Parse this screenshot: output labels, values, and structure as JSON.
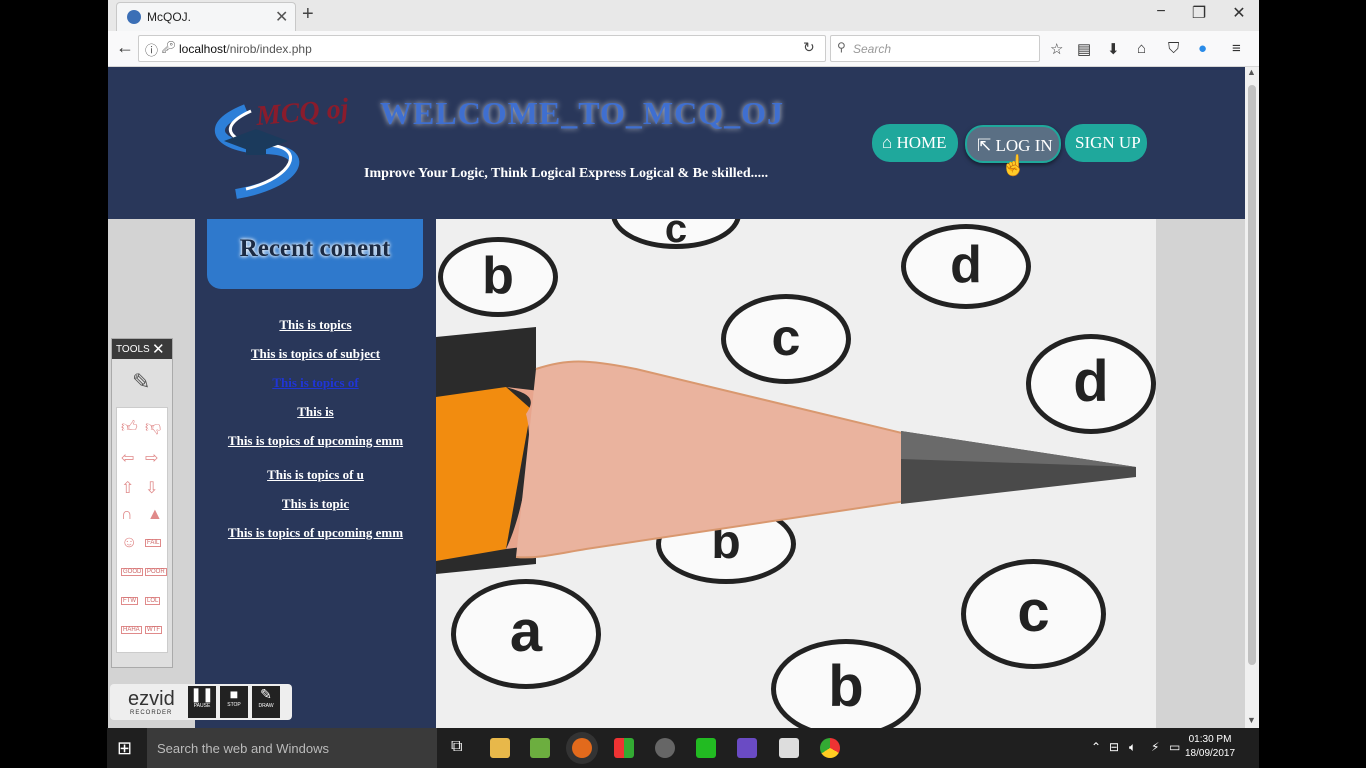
{
  "browser": {
    "tab_title": "McQOJ.",
    "new_tab": "+",
    "url_host": "localhost",
    "url_path": "/nirob/index.php",
    "search_placeholder": "Search",
    "window": {
      "minimize": "−",
      "restore": "❐",
      "close": "✕"
    }
  },
  "header": {
    "logo_text": "MCQ oj",
    "welcome": "WELCOME_TO_MCQ_OJ",
    "tagline": "Improve Your Logic, Think Logical Express Logical & Be skilled.....",
    "nav": {
      "home": "HOME",
      "login": "LOG IN",
      "signup": "SIGN UP"
    }
  },
  "sidebar": {
    "title": "Recent conent",
    "topics": [
      "This is topics",
      "This is topics of subject",
      "This is topics of",
      "This is",
      "This is topics of upcoming emm",
      "This is topics of u",
      "This is topic",
      "This is topics of upcoming emm"
    ]
  },
  "hero": {
    "bubbles": [
      "b",
      "c",
      "d",
      "c",
      "d",
      "b",
      "a",
      "b",
      "c"
    ]
  },
  "recorder": {
    "tools_title": "TOOLS",
    "tools_close": "✕",
    "brand": "ezvid",
    "brand_sub": "RECORDER",
    "buttons": [
      "PAUSE",
      "STOP",
      "DRAW"
    ],
    "tool_labels": [
      "PASS",
      "FAIL",
      "GOOD",
      "POOR",
      "FTW",
      "LOL",
      "HAHA",
      "WTF"
    ]
  },
  "taskbar": {
    "search_placeholder": "Search the web and Windows",
    "time": "01:30 PM",
    "date": "18/09/2017"
  },
  "colors": {
    "header_bg": "#29375a",
    "nav_teal": "#1fa89c",
    "sidebar_title_bg": "#2f79cc",
    "active_link": "#1f35d6"
  }
}
